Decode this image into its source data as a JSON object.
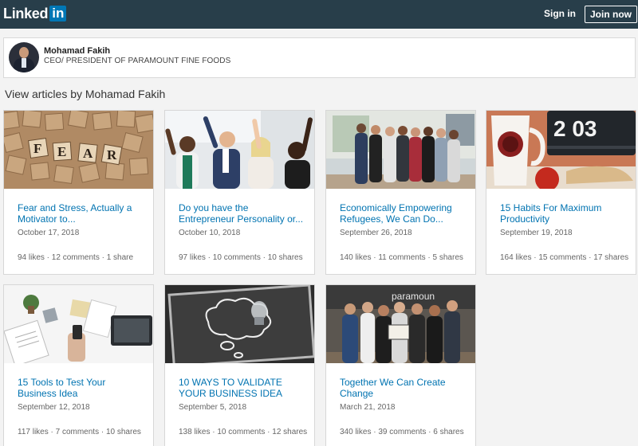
{
  "header": {
    "logo_text": "Linked",
    "logo_in": "in",
    "signin_label": "Sign in",
    "join_label": "Join now"
  },
  "profile": {
    "name": "Mohamad Fakih",
    "title": "CEO/ PRESIDENT OF PARAMOUNT FINE FOODS"
  },
  "section_title": "View articles by Mohamad Fakih",
  "articles": [
    {
      "title": "Fear and Stress, Actually a Motivator to...",
      "date": "October 17, 2018",
      "stats": "94 likes · 12 comments · 1 share"
    },
    {
      "title": "Do you have the Entrepreneur Personality or...",
      "date": "October 10, 2018",
      "stats": "97 likes · 10 comments · 10 shares"
    },
    {
      "title": "Economically Empowering Refugees, We Can Do...",
      "date": "September 26, 2018",
      "stats": "140 likes · 11 comments · 5 shares"
    },
    {
      "title": "15 Habits For Maximum Productivity",
      "date": "September 19, 2018",
      "stats": "164 likes · 15 comments · 17 shares"
    },
    {
      "title": "15 Tools to Test Your Business Idea",
      "date": "September 12, 2018",
      "stats": "117 likes · 7 comments · 10 shares"
    },
    {
      "title": "10 WAYS TO VALIDATE YOUR BUSINESS IDEA",
      "date": "September 5, 2018",
      "stats": "138 likes · 10 comments · 12 shares"
    },
    {
      "title": "Together We Can Create Change",
      "date": "March 21, 2018",
      "stats": "340 likes · 39 comments · 6 shares"
    }
  ],
  "thumb_texts": {
    "fear_tiles": [
      "F",
      "E",
      "A",
      "R"
    ],
    "clock_digits": "2 03",
    "store_sign": "paramoun"
  }
}
